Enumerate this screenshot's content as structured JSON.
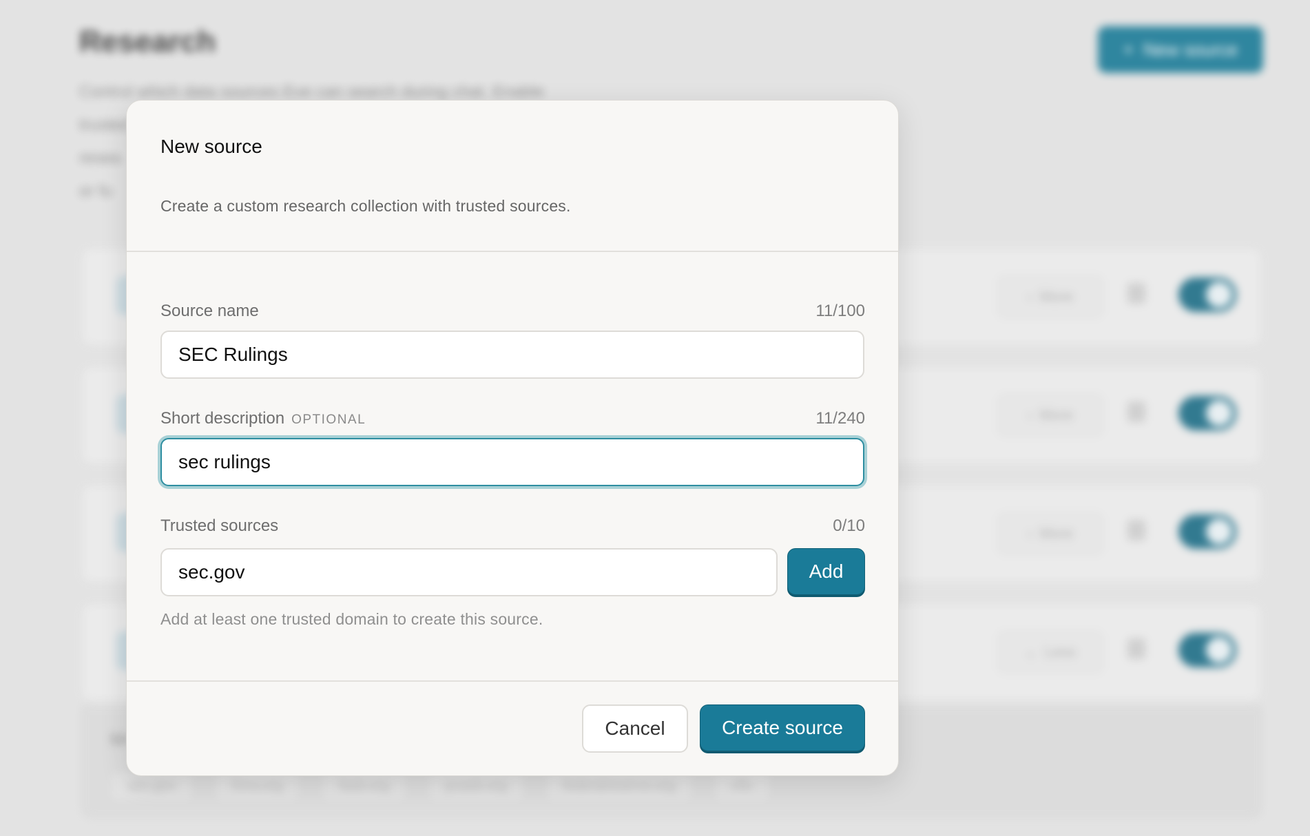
{
  "background": {
    "title": "Research",
    "new_button_label": "New source",
    "description_line1": "Control which data sources Eve can search during chat. Enable",
    "description_line2": "trusted",
    "description_line3": "resea",
    "description_line4": "or fu",
    "cards": [
      {
        "more_label": "More",
        "enabled": true
      },
      {
        "more_label": "More",
        "enabled": true
      },
      {
        "more_label": "More",
        "enabled": true
      },
      {
        "more_label": "Less",
        "enabled": true
      }
    ],
    "footer_label": "Sit",
    "chips": [
      "sec.gov",
      "finra.org",
      "fasb.org",
      "pcaob.org",
      "federalreserve.org",
      "cftc"
    ]
  },
  "modal": {
    "title": "New source",
    "subtitle": "Create a custom research collection with trusted sources.",
    "source_name": {
      "label": "Source name",
      "counter": "11/100",
      "value": "SEC Rulings"
    },
    "short_description": {
      "label": "Short description",
      "optional_tag": "OPTIONAL",
      "counter": "11/240",
      "value": "sec rulings"
    },
    "trusted_sources": {
      "label": "Trusted sources",
      "counter": "0/10",
      "value": "sec.gov",
      "add_label": "Add",
      "hint": "Add at least one trusted domain to create this source."
    },
    "cancel_label": "Cancel",
    "create_label": "Create source"
  },
  "colors": {
    "accent": "#1a7b98",
    "focus_ring": "#47a1b2",
    "modal_bg": "#f8f7f5",
    "overlay_bg": "#e3e3e3"
  }
}
